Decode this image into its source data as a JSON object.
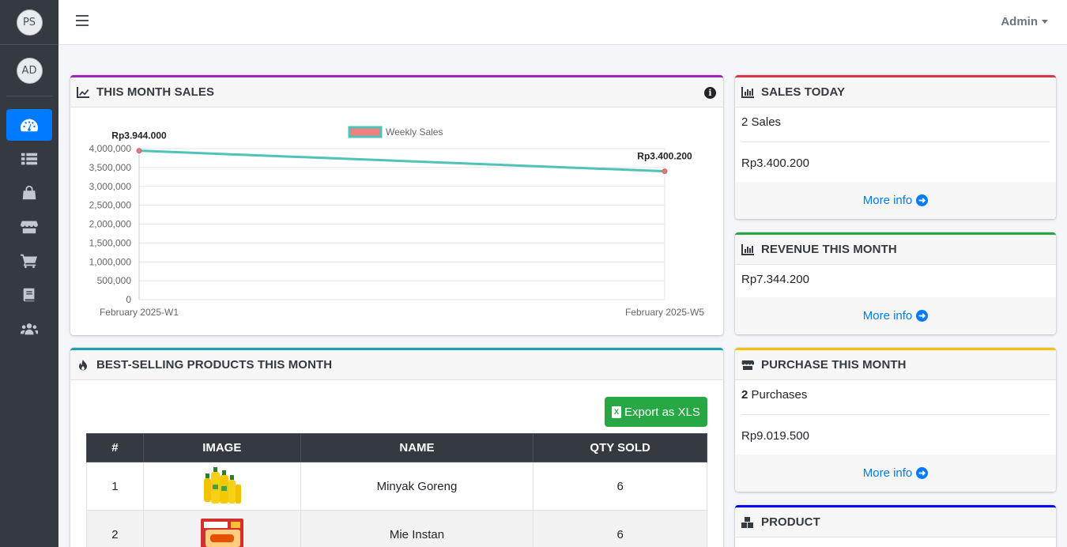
{
  "sidebar": {
    "brand_initials": "PS",
    "user_initials": "AD",
    "items": [
      {
        "icon": "dashboard-icon",
        "active": true
      },
      {
        "icon": "list-icon",
        "active": false
      },
      {
        "icon": "shopping-bag-icon",
        "active": false
      },
      {
        "icon": "store-icon",
        "active": false
      },
      {
        "icon": "cart-icon",
        "active": false
      },
      {
        "icon": "book-icon",
        "active": false
      },
      {
        "icon": "users-icon",
        "active": false
      }
    ]
  },
  "topbar": {
    "user_menu": "Admin"
  },
  "sales_chart": {
    "title": "THIS MONTH SALES",
    "info": "i"
  },
  "chart_data": {
    "type": "line",
    "x": [
      "February 2025-W1",
      "February 2025-W5"
    ],
    "series": [
      {
        "name": "Weekly Sales",
        "values": [
          3944000,
          3400200
        ],
        "color": "#4fc3b8"
      }
    ],
    "data_labels": [
      "Rp3.944.000",
      "Rp3.400.200"
    ],
    "y_ticks": [
      "0",
      "500,000",
      "1,000,000",
      "1,500,000",
      "2,000,000",
      "2,500,000",
      "3,000,000",
      "3,500,000",
      "4,000,000"
    ],
    "ylim": [
      0,
      4000000
    ],
    "legend_position": "top",
    "legend_swatch_color": "#f08080",
    "grid": true
  },
  "best_selling": {
    "title": "BEST-SELLING PRODUCTS THIS MONTH",
    "export_label": "Export as XLS",
    "export_icon_text": "X",
    "columns": [
      "#",
      "IMAGE",
      "NAME",
      "QTY SOLD"
    ],
    "rows": [
      {
        "no": "1",
        "name": "Minyak Goreng",
        "qty": "6"
      },
      {
        "no": "2",
        "name": "Mie Instan",
        "qty": "6"
      }
    ]
  },
  "sales_today": {
    "title": "SALES TODAY",
    "count": "2 Sales",
    "amount": "Rp3.400.200",
    "more": "More info",
    "accent": "#dc3545"
  },
  "revenue": {
    "title": "REVENUE THIS MONTH",
    "amount": "Rp7.344.200",
    "more": "More info",
    "accent": "#28a745"
  },
  "purchase": {
    "title": "PURCHASE THIS MONTH",
    "count_num": "2",
    "count_label": " Purchases",
    "amount": "Rp9.019.500",
    "more": "More info",
    "accent": "#ffc107"
  },
  "product": {
    "title": "PRODUCT",
    "accent": "#0000ff"
  },
  "colors": {
    "chart_card_accent": "#9c27b0",
    "table_card_accent": "#17a2b8",
    "primary": "#007bff",
    "success": "#28a745"
  }
}
